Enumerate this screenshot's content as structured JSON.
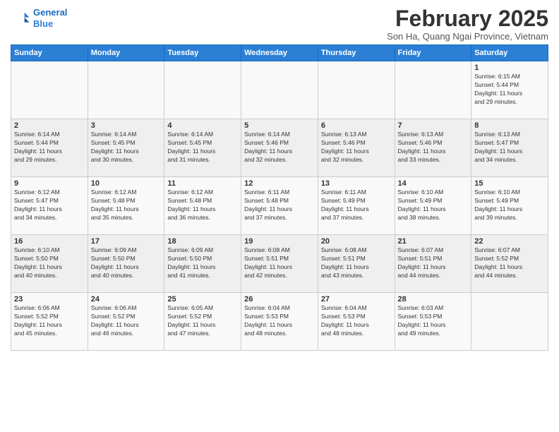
{
  "logo": {
    "line1": "General",
    "line2": "Blue"
  },
  "title": "February 2025",
  "subtitle": "Son Ha, Quang Ngai Province, Vietnam",
  "days_of_week": [
    "Sunday",
    "Monday",
    "Tuesday",
    "Wednesday",
    "Thursday",
    "Friday",
    "Saturday"
  ],
  "weeks": [
    [
      {
        "day": "",
        "info": ""
      },
      {
        "day": "",
        "info": ""
      },
      {
        "day": "",
        "info": ""
      },
      {
        "day": "",
        "info": ""
      },
      {
        "day": "",
        "info": ""
      },
      {
        "day": "",
        "info": ""
      },
      {
        "day": "1",
        "info": "Sunrise: 6:15 AM\nSunset: 5:44 PM\nDaylight: 11 hours\nand 29 minutes."
      }
    ],
    [
      {
        "day": "2",
        "info": "Sunrise: 6:14 AM\nSunset: 5:44 PM\nDaylight: 11 hours\nand 29 minutes."
      },
      {
        "day": "3",
        "info": "Sunrise: 6:14 AM\nSunset: 5:45 PM\nDaylight: 11 hours\nand 30 minutes."
      },
      {
        "day": "4",
        "info": "Sunrise: 6:14 AM\nSunset: 5:45 PM\nDaylight: 11 hours\nand 31 minutes."
      },
      {
        "day": "5",
        "info": "Sunrise: 6:14 AM\nSunset: 5:46 PM\nDaylight: 11 hours\nand 32 minutes."
      },
      {
        "day": "6",
        "info": "Sunrise: 6:13 AM\nSunset: 5:46 PM\nDaylight: 11 hours\nand 32 minutes."
      },
      {
        "day": "7",
        "info": "Sunrise: 6:13 AM\nSunset: 5:46 PM\nDaylight: 11 hours\nand 33 minutes."
      },
      {
        "day": "8",
        "info": "Sunrise: 6:13 AM\nSunset: 5:47 PM\nDaylight: 11 hours\nand 34 minutes."
      }
    ],
    [
      {
        "day": "9",
        "info": "Sunrise: 6:12 AM\nSunset: 5:47 PM\nDaylight: 11 hours\nand 34 minutes."
      },
      {
        "day": "10",
        "info": "Sunrise: 6:12 AM\nSunset: 5:48 PM\nDaylight: 11 hours\nand 35 minutes."
      },
      {
        "day": "11",
        "info": "Sunrise: 6:12 AM\nSunset: 5:48 PM\nDaylight: 11 hours\nand 36 minutes."
      },
      {
        "day": "12",
        "info": "Sunrise: 6:11 AM\nSunset: 5:48 PM\nDaylight: 11 hours\nand 37 minutes."
      },
      {
        "day": "13",
        "info": "Sunrise: 6:11 AM\nSunset: 5:49 PM\nDaylight: 11 hours\nand 37 minutes."
      },
      {
        "day": "14",
        "info": "Sunrise: 6:10 AM\nSunset: 5:49 PM\nDaylight: 11 hours\nand 38 minutes."
      },
      {
        "day": "15",
        "info": "Sunrise: 6:10 AM\nSunset: 5:49 PM\nDaylight: 11 hours\nand 39 minutes."
      }
    ],
    [
      {
        "day": "16",
        "info": "Sunrise: 6:10 AM\nSunset: 5:50 PM\nDaylight: 11 hours\nand 40 minutes."
      },
      {
        "day": "17",
        "info": "Sunrise: 6:09 AM\nSunset: 5:50 PM\nDaylight: 11 hours\nand 40 minutes."
      },
      {
        "day": "18",
        "info": "Sunrise: 6:09 AM\nSunset: 5:50 PM\nDaylight: 11 hours\nand 41 minutes."
      },
      {
        "day": "19",
        "info": "Sunrise: 6:08 AM\nSunset: 5:51 PM\nDaylight: 11 hours\nand 42 minutes."
      },
      {
        "day": "20",
        "info": "Sunrise: 6:08 AM\nSunset: 5:51 PM\nDaylight: 11 hours\nand 43 minutes."
      },
      {
        "day": "21",
        "info": "Sunrise: 6:07 AM\nSunset: 5:51 PM\nDaylight: 11 hours\nand 44 minutes."
      },
      {
        "day": "22",
        "info": "Sunrise: 6:07 AM\nSunset: 5:52 PM\nDaylight: 11 hours\nand 44 minutes."
      }
    ],
    [
      {
        "day": "23",
        "info": "Sunrise: 6:06 AM\nSunset: 5:52 PM\nDaylight: 11 hours\nand 45 minutes."
      },
      {
        "day": "24",
        "info": "Sunrise: 6:06 AM\nSunset: 5:52 PM\nDaylight: 11 hours\nand 46 minutes."
      },
      {
        "day": "25",
        "info": "Sunrise: 6:05 AM\nSunset: 5:52 PM\nDaylight: 11 hours\nand 47 minutes."
      },
      {
        "day": "26",
        "info": "Sunrise: 6:04 AM\nSunset: 5:53 PM\nDaylight: 11 hours\nand 48 minutes."
      },
      {
        "day": "27",
        "info": "Sunrise: 6:04 AM\nSunset: 5:53 PM\nDaylight: 11 hours\nand 48 minutes."
      },
      {
        "day": "28",
        "info": "Sunrise: 6:03 AM\nSunset: 5:53 PM\nDaylight: 11 hours\nand 49 minutes."
      },
      {
        "day": "",
        "info": ""
      }
    ]
  ]
}
